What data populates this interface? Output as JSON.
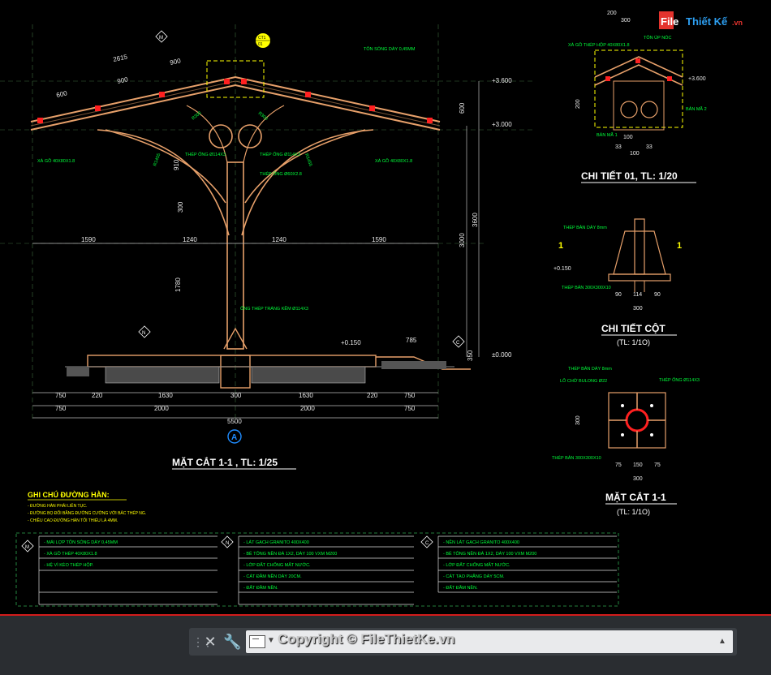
{
  "logo": {
    "part1": "File",
    "part2": "Thiết Kế",
    "part3": ".vn"
  },
  "main_section": {
    "title": "MẶT CẮT 1-1 , TL: 1/25",
    "axis_label": "A",
    "marker_m": "M",
    "marker_n": "N",
    "marker_c": "C",
    "detail_ref_top": "CT1",
    "detail_ref_bot": "01",
    "roof_note": "TÔN SÓNG DÀY 0,45MM",
    "purlin_note": "XÀ GỒ 40X80X1.8",
    "purlin_note2": "XÀ GỒ 40X80X1.8",
    "pipe_note1": "THÉP ỐNG Ø114X3",
    "pipe_note2": "THÉP ỐNG Ø114X3",
    "pipe_note3": "THÉP ỐNG Ø60X2.8",
    "base_pipe_note": "ỐNG THÉP TRÁNG KẼM Ø114X3",
    "radius1": "R1455",
    "radius2": "R1455",
    "radius3": "R300",
    "radius4": "R300",
    "dims_top": [
      "2615",
      "900",
      "900",
      "600"
    ],
    "dims_mid": [
      "1590",
      "1240",
      "1240",
      "1590"
    ],
    "dims_vert": [
      "910",
      "300",
      "1780",
      "600",
      "3000",
      "3600"
    ],
    "dims_bottom1": [
      "750",
      "220",
      "1630",
      "300",
      "1630",
      "220",
      "750"
    ],
    "dims_bottom2": [
      "750",
      "2000",
      "2000",
      "750"
    ],
    "dim_total": "5500",
    "dim_785": "785",
    "dim_350": "350",
    "levels": [
      "+3.600",
      "+3.000",
      "+0.150",
      "±0.000"
    ]
  },
  "detail01": {
    "title": "CHI TIẾT 01, TL: 1/20",
    "note1": "XÀ GỒ THÉP HỘP 40X80X1.8",
    "note2": "TÔN ÚP NÓC",
    "note3": "BẢN MÃ 2",
    "note4": "BẢN MÃ 1",
    "level": "+3.600",
    "dims": [
      "200",
      "300",
      "200",
      "100",
      "33",
      "33",
      "100"
    ]
  },
  "column_detail": {
    "title": "CHI TIẾT CỘT",
    "scale": "(TL: 1/1O)",
    "note1": "THÉP BẢN DÀY 8mm",
    "note2": "THÉP BẢN 300X300X10",
    "level": "+0.150",
    "section_mark": "1",
    "dims": [
      "90",
      "114",
      "90",
      "300"
    ]
  },
  "section_detail": {
    "title": "MẶT CẮT 1-1",
    "scale": "(TL: 1/1O)",
    "note1": "THÉP BẢN DÀY 8mm",
    "note2": "LỖ CHỜ BULONG Ø22",
    "note3": "THÉP ỐNG Ø114X3",
    "note4": "THÉP BẢN 300X300X10",
    "dims": [
      "75",
      "150",
      "75",
      "300"
    ]
  },
  "weld_notes": {
    "title": "GHI CHÚ ĐƯỜNG HÀN:",
    "lines": [
      "- ĐƯỜNG HÀN PHẢI LIÊN TỤC.",
      "- ĐƯỜNG BỌ ĐỐI BẰNG ĐƯỜNG CƯỜNG VỚI BẢC THÉP NG.",
      "- CHIỀU CAO ĐƯỜNG HÀN TỐI THIỂU LÀ 4MM."
    ]
  },
  "legend": [
    {
      "marker": "M",
      "items": [
        "- MÁI LỢP TÔN SÓNG DÀY 0,45MM",
        "- XÀ GỒ THÉP 40X80X1.8",
        "- HỆ VÌ KÈO THÉP HỘP."
      ]
    },
    {
      "marker": "N",
      "items": [
        "- LÁT GẠCH GRANITO 400X400",
        "- BÊ TÔNG NỀN ĐÁ 1X2, DÀY 100 VXM M200",
        "- LỚP ĐẤT CHỐNG MẤT NƯỚC.",
        "- CÁT ĐẦM NỀN DÀY 20CM.",
        "- ĐẤT ĐẦM NỀN."
      ]
    },
    {
      "marker": "C",
      "items": [
        "- NỀN LÁT GẠCH GRANITO 400X400",
        "- BÊ TÔNG NỀN ĐÁ 1X2, DÀY 100 VXM M200",
        "- LỚP ĐẤT CHỐNG MẤT NƯỚC.",
        "- CÁT TẠO PHẲNG DÀY 5CM.",
        "- ĐẤT ĐẦM NỀN."
      ]
    }
  ],
  "command_bar": {
    "close": "✕",
    "wrench": "🔧",
    "placeholder": "",
    "history": "▲",
    "watermark": "Copyright © FileThietKe.vn"
  }
}
